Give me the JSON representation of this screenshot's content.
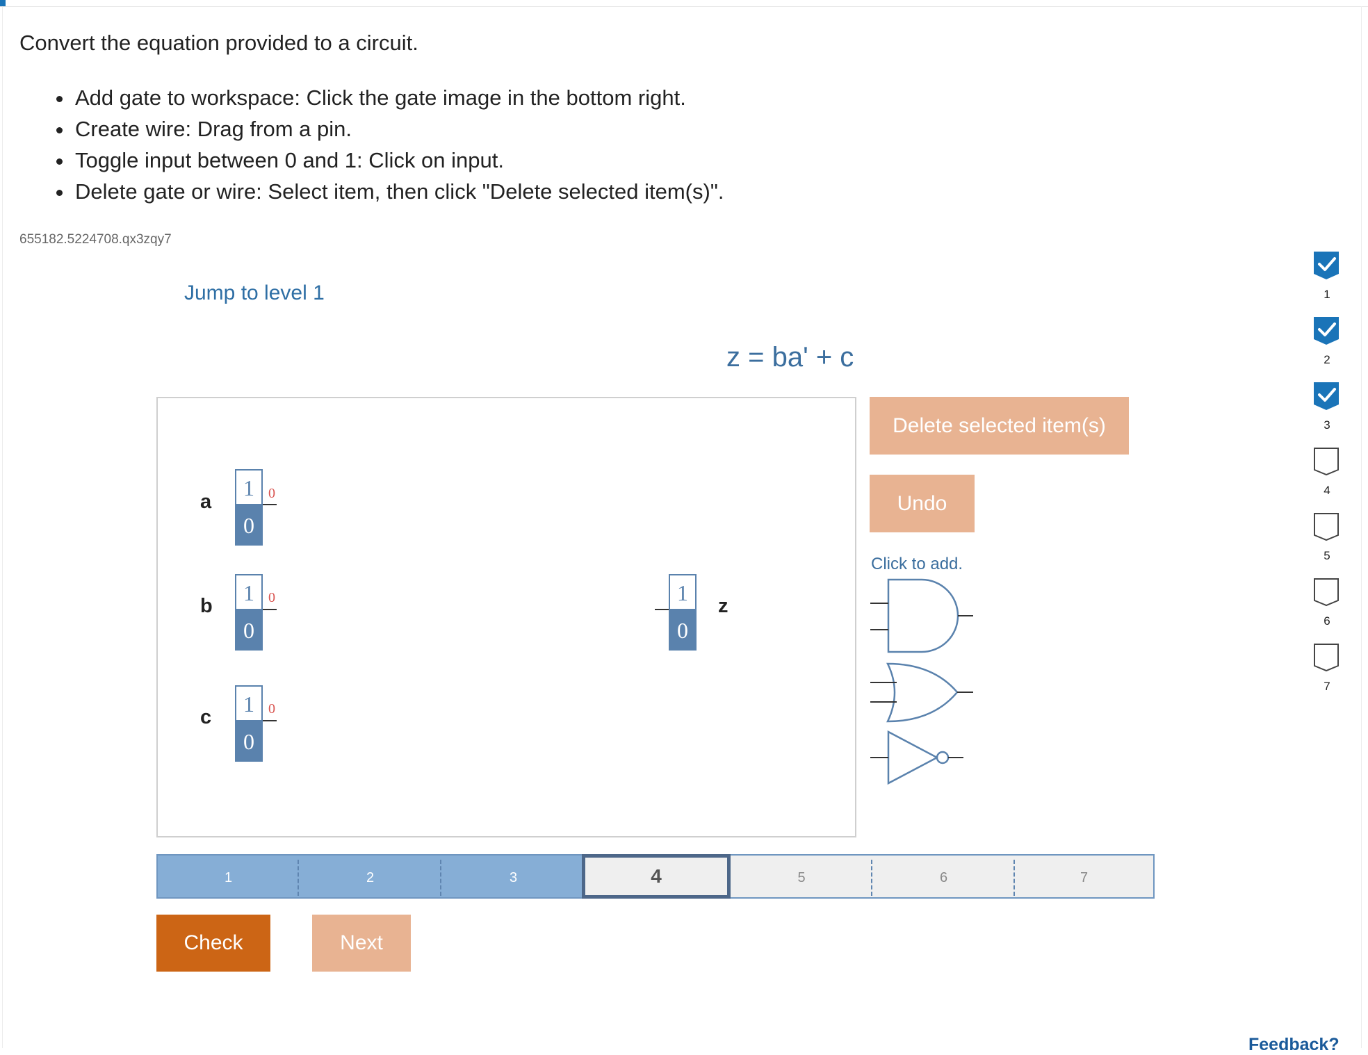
{
  "instructions": {
    "heading": "Convert the equation provided to a circuit.",
    "bullets": [
      "Add gate to workspace: Click the gate image in the bottom right.",
      "Create wire: Drag from a pin.",
      "Toggle input between 0 and 1: Click on input.",
      "Delete gate or wire: Select item, then click \"Delete selected item(s)\"."
    ],
    "prompt_id": "655182.5224708.qx3zqy7"
  },
  "activity": {
    "jump_link": "Jump to level 1",
    "equation": "z = ba' + c"
  },
  "workspace": {
    "inputs": [
      {
        "name": "a",
        "top_label": "1",
        "bottom_label": "0",
        "output": "0"
      },
      {
        "name": "b",
        "top_label": "1",
        "bottom_label": "0",
        "output": "0"
      },
      {
        "name": "c",
        "top_label": "1",
        "bottom_label": "0",
        "output": "0"
      }
    ],
    "output": {
      "name": "z",
      "top_label": "1",
      "bottom_label": "0"
    }
  },
  "tools": {
    "delete_label": "Delete selected item(s)",
    "undo_label": "Undo",
    "click_to_add": "Click to add.",
    "gates": [
      "and-gate-icon",
      "or-gate-icon",
      "not-gate-icon"
    ]
  },
  "levels": {
    "items": [
      "1",
      "2",
      "3",
      "4",
      "5",
      "6",
      "7"
    ],
    "current": 4,
    "completed": 3
  },
  "actions": {
    "check_label": "Check",
    "next_label": "Next"
  },
  "progress": {
    "items": [
      {
        "num": "1",
        "state": "checked"
      },
      {
        "num": "2",
        "state": "checked"
      },
      {
        "num": "3",
        "state": "checked"
      },
      {
        "num": "4",
        "state": "empty"
      },
      {
        "num": "5",
        "state": "empty"
      },
      {
        "num": "6",
        "state": "empty"
      },
      {
        "num": "7",
        "state": "empty"
      }
    ]
  },
  "feedback_label": "Feedback?",
  "colors": {
    "accent_blue": "#3b6e9e",
    "toggle_blue": "#5a82ad",
    "check_orange": "#cc6515",
    "disabled_orange": "#e8b392",
    "progress_blue": "#1a74b8"
  }
}
